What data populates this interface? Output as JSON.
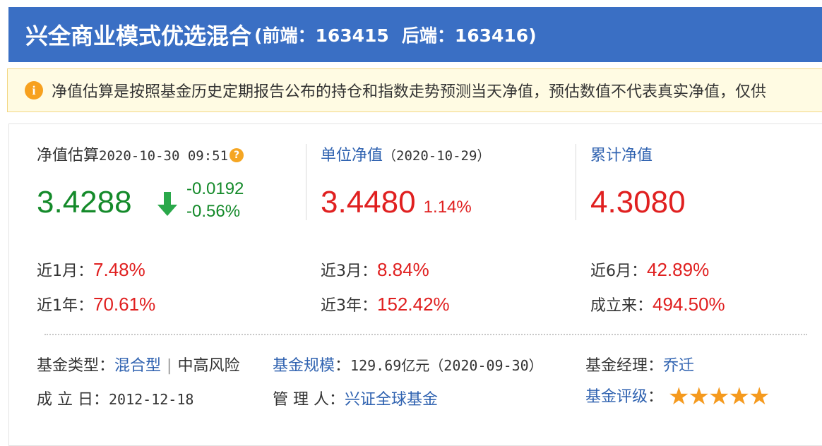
{
  "header": {
    "fund_name": "兴全商业模式优选混合",
    "open_paren": "(",
    "front_code": "前端：163415",
    "back_code": "后端：163416",
    "close_paren": ")"
  },
  "notice": {
    "text": "净值估算是按照基金历史定期报告公布的持仓和指数走势预测当天净值，预估数值不代表真实净值，仅供"
  },
  "estimate": {
    "label": "净值估算",
    "time": "2020-10-30 09:51",
    "value": "3.4288",
    "change": "-0.0192",
    "change_pct": "-0.56%",
    "color": "#148a2a"
  },
  "unit_nav": {
    "label": "单位净值",
    "date": "（2020-10-29）",
    "value": "3.4480",
    "change_pct": "1.14%"
  },
  "accum_nav": {
    "label": "累计净值",
    "value": "4.3080"
  },
  "performance": {
    "m1_label": "近1月：",
    "m1": "7.48%",
    "y1_label": "近1年：",
    "y1": "70.61%",
    "m3_label": "近3月：",
    "m3": "8.84%",
    "y3_label": "近3年：",
    "y3": "152.42%",
    "m6_label": "近6月：",
    "m6": "42.89%",
    "since_label": "成立来：",
    "since": "494.50%"
  },
  "info": {
    "type_label": "基金类型：",
    "type": "混合型",
    "pipe": "|",
    "risk": "中高风险",
    "scale_label": "基金规模",
    "scale_sep": "：",
    "scale": "129.69亿元（2020-09-30）",
    "manager_label": "基金经理：",
    "manager": "乔迁",
    "inception_label": "成 立 日：",
    "inception": "2012-12-18",
    "admin_label": "管 理 人：",
    "admin": "兴证全球基金",
    "rating_label": "基金评级",
    "rating_sep": "：",
    "rating_stars": 5
  },
  "colors": {
    "header_bg": "#3a6fc4",
    "up": "#e02020",
    "down": "#148a2a",
    "link": "#2f62b0",
    "star": "#f59a1e"
  }
}
